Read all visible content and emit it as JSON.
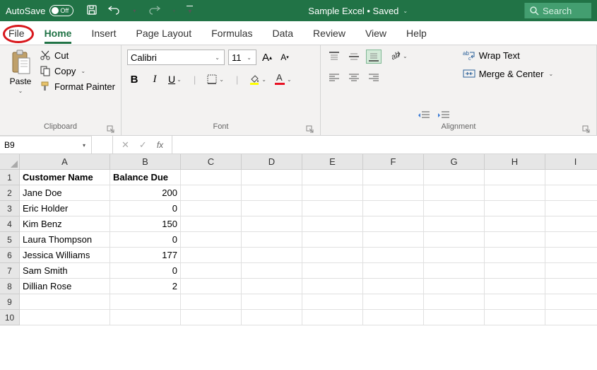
{
  "titlebar": {
    "autosave_label": "AutoSave",
    "autosave_state": "Off",
    "document_title": "Sample Excel • Saved",
    "search_placeholder": "Search"
  },
  "tabs": {
    "file": "File",
    "home": "Home",
    "insert": "Insert",
    "page_layout": "Page Layout",
    "formulas": "Formulas",
    "data": "Data",
    "review": "Review",
    "view": "View",
    "help": "Help"
  },
  "ribbon": {
    "clipboard": {
      "paste": "Paste",
      "cut": "Cut",
      "copy": "Copy",
      "format_painter": "Format Painter",
      "group_label": "Clipboard"
    },
    "font": {
      "font_name": "Calibri",
      "font_size": "11",
      "bold": "B",
      "italic": "I",
      "underline": "U",
      "group_label": "Font"
    },
    "alignment": {
      "wrap_text": "Wrap Text",
      "merge_center": "Merge & Center",
      "group_label": "Alignment"
    }
  },
  "formula_bar": {
    "name_box": "B9",
    "fx": "fx",
    "formula_value": ""
  },
  "columns": [
    "A",
    "B",
    "C",
    "D",
    "E",
    "F",
    "G",
    "H",
    "I"
  ],
  "rows": [
    "1",
    "2",
    "3",
    "4",
    "5",
    "6",
    "7",
    "8",
    "9",
    "10"
  ],
  "cells": {
    "A1": "Customer Name",
    "B1": "Balance Due",
    "A2": "Jane Doe",
    "B2": "200",
    "A3": "Eric Holder",
    "B3": "0",
    "A4": "Kim Benz",
    "B4": "150",
    "A5": "Laura Thompson",
    "B5": "0",
    "A6": "Jessica Williams",
    "B6": "177",
    "A7": "Sam Smith",
    "B7": "0",
    "A8": "Dillian Rose",
    "B8": "2"
  },
  "chart_data": {
    "type": "table",
    "columns": [
      "Customer Name",
      "Balance Due"
    ],
    "rows": [
      [
        "Jane Doe",
        200
      ],
      [
        "Eric Holder",
        0
      ],
      [
        "Kim Benz",
        150
      ],
      [
        "Laura Thompson",
        0
      ],
      [
        "Jessica Williams",
        177
      ],
      [
        "Sam Smith",
        0
      ],
      [
        "Dillian Rose",
        2
      ]
    ]
  }
}
